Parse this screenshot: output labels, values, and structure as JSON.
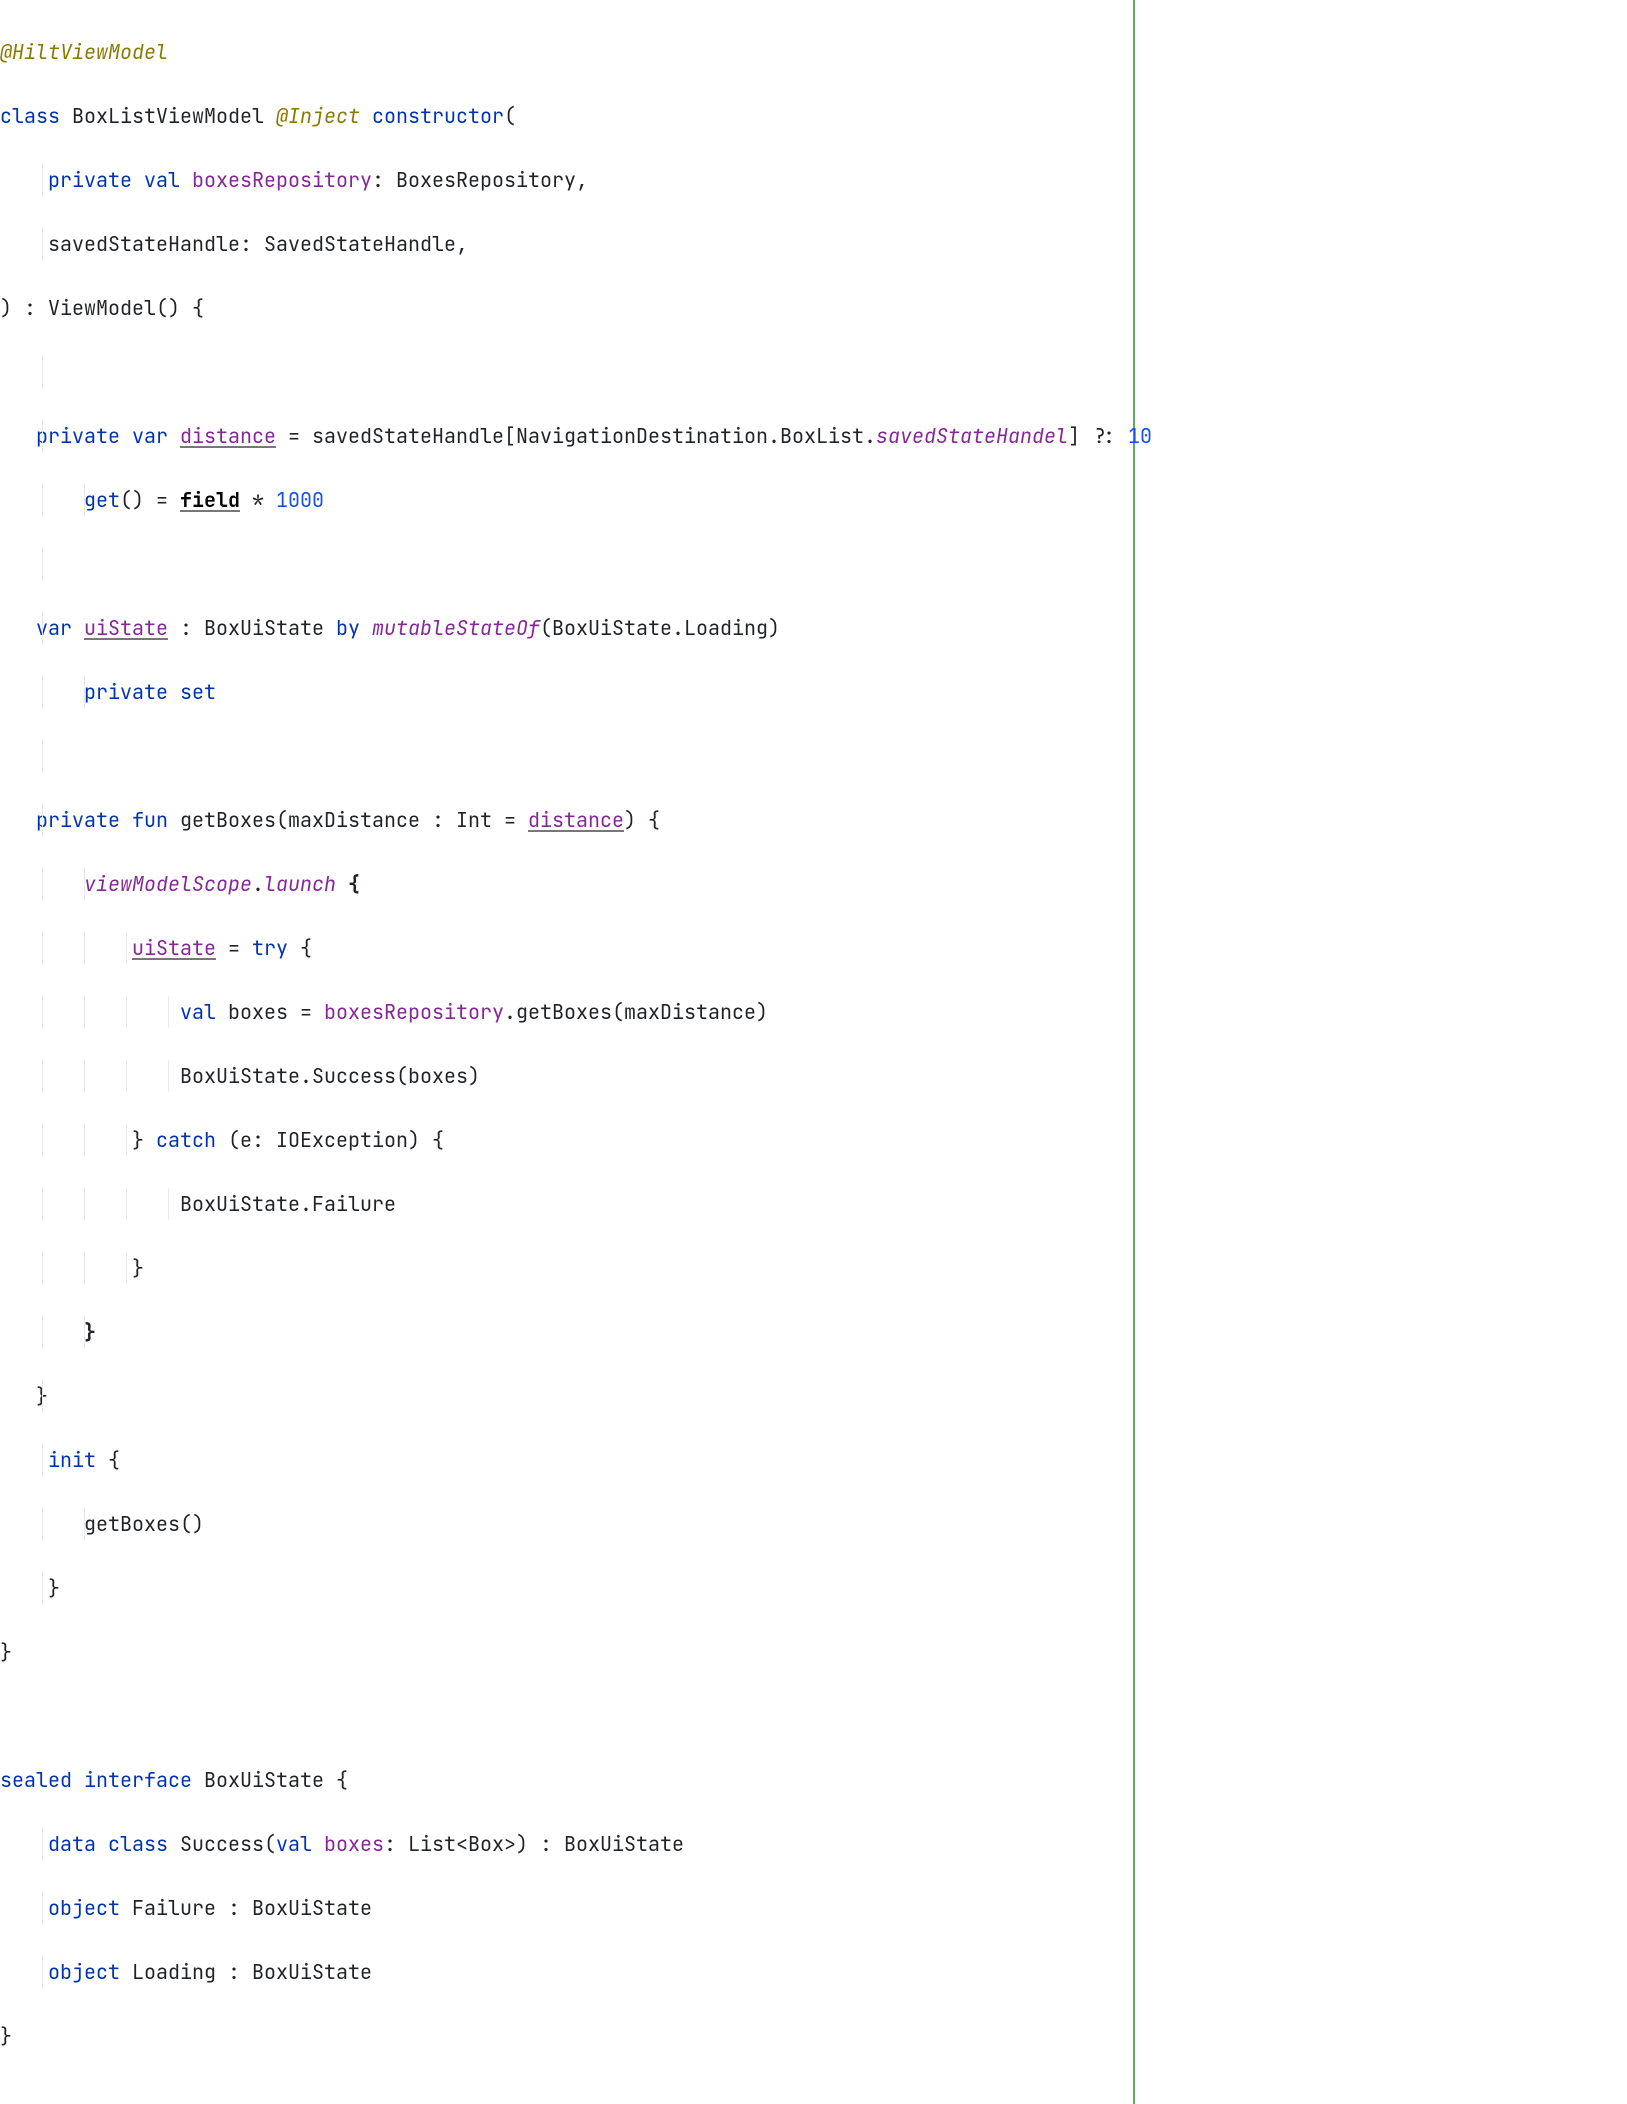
{
  "code": {
    "l1": {
      "anno": "@HiltViewModel"
    },
    "l2": {
      "kw_class": "class",
      "name": "BoxListViewModel",
      "inject": "@Inject",
      "ctor": "constructor",
      "open": "("
    },
    "l3": {
      "priv": "private",
      "val": "val",
      "name": "boxesRepository",
      "type": ": BoxesRepository,"
    },
    "l4": {
      "text": "savedStateHandle: SavedStateHandle,"
    },
    "l5": {
      "text": ") : ViewModel() {"
    },
    "l7": {
      "priv": "private",
      "var": "var",
      "name": "distance",
      "eq": " = savedStateHandle[NavigationDestination.BoxList.",
      "ssh": "savedStateHandel",
      "tail": "] ?: ",
      "num": "10"
    },
    "l8": {
      "get": "get",
      "mid": "() = ",
      "field": "field",
      "star": " * ",
      "num": "1000"
    },
    "l10": {
      "var": "var",
      "name": "uiState",
      "mid": " : BoxUiState ",
      "by": "by",
      "msof": "mutableStateOf",
      "tail": "(BoxUiState.Loading)"
    },
    "l11": {
      "priv": "private",
      "set": "set"
    },
    "l13": {
      "priv": "private",
      "fun": "fun",
      "name": "getBoxes",
      "open": "(maxDistance : Int = ",
      "dist": "distance",
      "close": ") {"
    },
    "l14": {
      "vms": "viewModelScope",
      "dot": ".",
      "launch": "launch",
      "brace": " {",
      "bold": true
    },
    "l15": {
      "ui": "uiState",
      "eq": " = ",
      "try": "try",
      "brace": " {"
    },
    "l16": {
      "val": "val",
      "boxes": "boxes",
      "eq": " = ",
      "repo": "boxesRepository",
      "call": ".getBoxes(maxDistance)"
    },
    "l17": {
      "text": "BoxUiState.Success(boxes)"
    },
    "l18": {
      "close": "} ",
      "catch": "catch",
      "args": " (e: IOException) {"
    },
    "l19": {
      "text": "BoxUiState.Failure"
    },
    "l20": {
      "text": "}"
    },
    "l21": {
      "text": "}",
      "bold": true
    },
    "l22": {
      "text": "}"
    },
    "l23": {
      "init": "init",
      "brace": " {"
    },
    "l24": {
      "text": "getBoxes()"
    },
    "l25": {
      "text": "}"
    },
    "l26": {
      "text": "}"
    },
    "l28": {
      "sealed": "sealed",
      "iface": "interface",
      "name": "BoxUiState {"
    },
    "l29": {
      "data": "data",
      "cls": "class",
      "name": "Success(",
      "val": "val",
      "boxes": "boxes",
      "tail": ": List<Box>) : BoxUiState"
    },
    "l30": {
      "obj": "object",
      "name": "Failure : BoxUiState"
    },
    "l31": {
      "obj": "object",
      "name": "Loading : BoxUiState"
    },
    "l32": {
      "text": "}"
    }
  }
}
